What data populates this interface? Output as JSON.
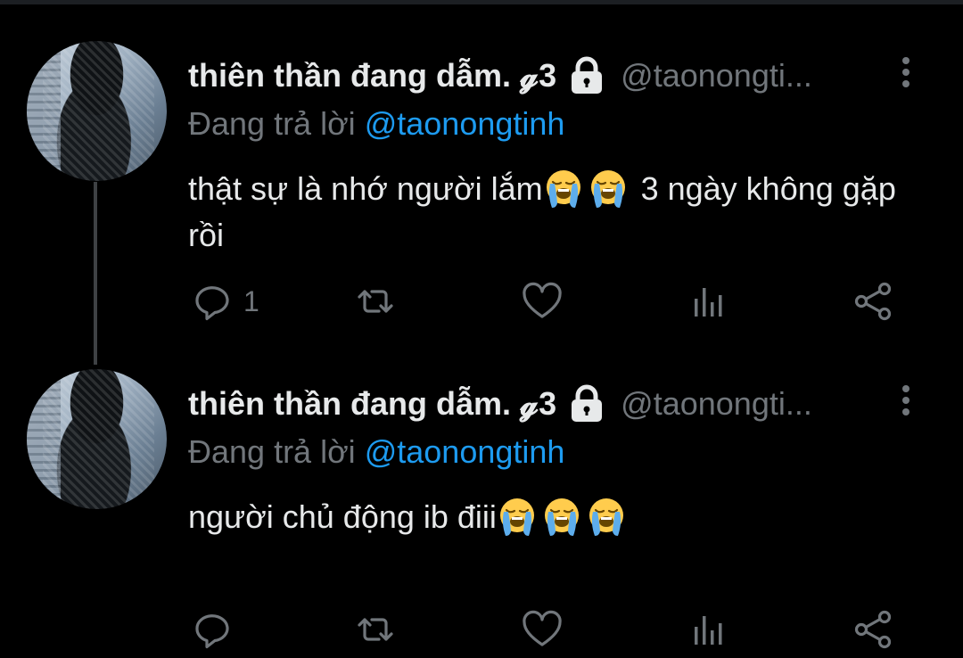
{
  "tweets": [
    {
      "display_name": "thiên thần đang dẫm. 𝓰3",
      "handle": "@taonongti...",
      "reply_prefix": "Đang trả lời",
      "reply_to": "@taonongtinh",
      "text": "thật sự là nhớ người lắm",
      "text_emojis": [
        "loudly-crying-face",
        "loudly-crying-face"
      ],
      "text_after": " 3 ngày không gặp rồi",
      "reply_count": "1"
    },
    {
      "display_name": "thiên thần đang dẫm. 𝓰3",
      "handle": "@taonongti...",
      "reply_prefix": "Đang trả lời",
      "reply_to": "@taonongtinh",
      "text": "người chủ động ib điii",
      "text_emojis": [
        "loudly-crying-face",
        "loudly-crying-face",
        "loudly-crying-face"
      ],
      "text_after": "",
      "reply_count": ""
    }
  ],
  "icons": {
    "lock": "lock-icon",
    "more": "more-vertical-icon",
    "reply": "reply-icon",
    "retweet": "retweet-icon",
    "like": "heart-icon",
    "views": "analytics-icon",
    "share": "share-icon"
  },
  "colors": {
    "background": "#000000",
    "text": "#e7e9ea",
    "secondary": "#71767b",
    "accent": "#1d9bf0",
    "thread_line": "#3e4144"
  }
}
